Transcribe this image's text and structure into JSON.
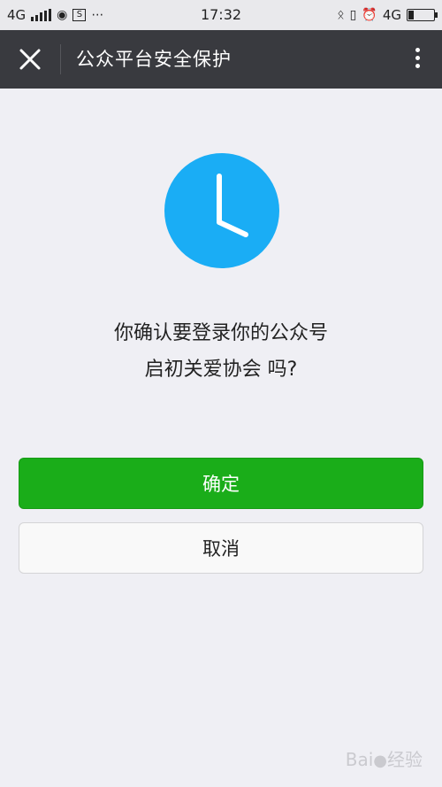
{
  "status_bar": {
    "left_network": "4G",
    "time": "17:32",
    "right_network": "4G",
    "icons": [
      "signal-icon",
      "app-notification-icon",
      "s-notification-icon",
      "more-dots-icon",
      "bluetooth-icon",
      "vibrate-icon",
      "alarm-icon",
      "battery-icon"
    ],
    "battery_level": 0.2
  },
  "title_bar": {
    "title": "公众平台安全保护",
    "close_icon": "close-icon",
    "more_icon": "more-vertical-icon"
  },
  "main": {
    "icon": "clock-icon",
    "accent_color": "#1aadf5",
    "message_line1": "你确认要登录你的公众号",
    "message_line2": "启初关爱协会 吗?"
  },
  "buttons": {
    "confirm_label": "确定",
    "cancel_label": "取消",
    "confirm_color": "#1aad19"
  },
  "watermark": "Bai du 经验"
}
